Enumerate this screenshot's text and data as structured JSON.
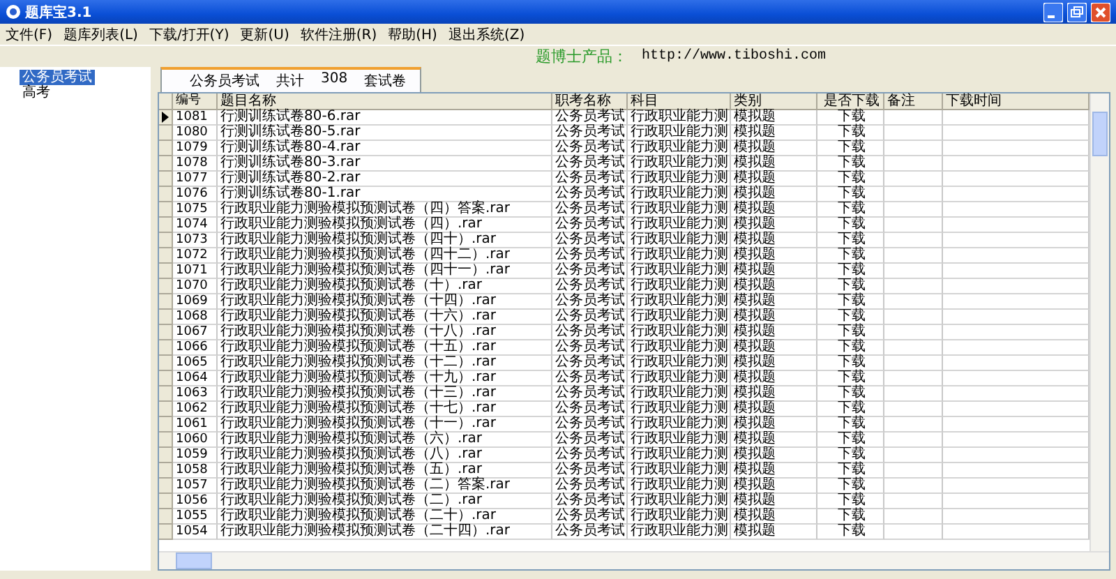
{
  "window": {
    "title": "题库宝3.1"
  },
  "menu": [
    "文件(F)",
    "题库列表(L)",
    "下载/打开(Y)",
    "更新(U)",
    "软件注册(R)",
    "帮助(H)",
    "退出系统(Z)"
  ],
  "banner": {
    "label": "题博士产品：",
    "url": "http://www.tiboshi.com"
  },
  "tree": [
    {
      "label": "公务员考试",
      "selected": true
    },
    {
      "label": "高考",
      "selected": false
    }
  ],
  "tab": {
    "parts": [
      "公务员考试",
      "共计",
      "308",
      "套试卷"
    ],
    "selected": true
  },
  "table": {
    "columns": [
      "编号",
      "题目名称",
      "职考名称",
      "科目",
      "类别",
      "是否下载",
      "备注",
      "下载时间"
    ],
    "rows": [
      {
        "id": "1081",
        "title": "行测训练试卷80-6.rar",
        "exam": "公务员考试",
        "subject": "行政职业能力测",
        "category": "模拟题",
        "download": "下载",
        "current": true
      },
      {
        "id": "1080",
        "title": "行测训练试卷80-5.rar",
        "exam": "公务员考试",
        "subject": "行政职业能力测",
        "category": "模拟题",
        "download": "下载",
        "current": false
      },
      {
        "id": "1079",
        "title": "行测训练试卷80-4.rar",
        "exam": "公务员考试",
        "subject": "行政职业能力测",
        "category": "模拟题",
        "download": "下载",
        "current": false
      },
      {
        "id": "1078",
        "title": "行测训练试卷80-3.rar",
        "exam": "公务员考试",
        "subject": "行政职业能力测",
        "category": "模拟题",
        "download": "下载",
        "current": false
      },
      {
        "id": "1077",
        "title": "行测训练试卷80-2.rar",
        "exam": "公务员考试",
        "subject": "行政职业能力测",
        "category": "模拟题",
        "download": "下载",
        "current": false
      },
      {
        "id": "1076",
        "title": "行测训练试卷80-1.rar",
        "exam": "公务员考试",
        "subject": "行政职业能力测",
        "category": "模拟题",
        "download": "下载",
        "current": false
      },
      {
        "id": "1075",
        "title": "行政职业能力测验模拟预测试卷（四）答案.rar",
        "exam": "公务员考试",
        "subject": "行政职业能力测",
        "category": "模拟题",
        "download": "下载",
        "current": false
      },
      {
        "id": "1074",
        "title": "行政职业能力测验模拟预测试卷（四）.rar",
        "exam": "公务员考试",
        "subject": "行政职业能力测",
        "category": "模拟题",
        "download": "下载",
        "current": false
      },
      {
        "id": "1073",
        "title": "行政职业能力测验模拟预测试卷（四十）.rar",
        "exam": "公务员考试",
        "subject": "行政职业能力测",
        "category": "模拟题",
        "download": "下载",
        "current": false
      },
      {
        "id": "1072",
        "title": "行政职业能力测验模拟预测试卷（四十二）.rar",
        "exam": "公务员考试",
        "subject": "行政职业能力测",
        "category": "模拟题",
        "download": "下载",
        "current": false
      },
      {
        "id": "1071",
        "title": "行政职业能力测验模拟预测试卷（四十一）.rar",
        "exam": "公务员考试",
        "subject": "行政职业能力测",
        "category": "模拟题",
        "download": "下载",
        "current": false
      },
      {
        "id": "1070",
        "title": "行政职业能力测验模拟预测试卷（十）.rar",
        "exam": "公务员考试",
        "subject": "行政职业能力测",
        "category": "模拟题",
        "download": "下载",
        "current": false
      },
      {
        "id": "1069",
        "title": "行政职业能力测验模拟预测试卷（十四）.rar",
        "exam": "公务员考试",
        "subject": "行政职业能力测",
        "category": "模拟题",
        "download": "下载",
        "current": false
      },
      {
        "id": "1068",
        "title": "行政职业能力测验模拟预测试卷（十六）.rar",
        "exam": "公务员考试",
        "subject": "行政职业能力测",
        "category": "模拟题",
        "download": "下载",
        "current": false
      },
      {
        "id": "1067",
        "title": "行政职业能力测验模拟预测试卷（十八）.rar",
        "exam": "公务员考试",
        "subject": "行政职业能力测",
        "category": "模拟题",
        "download": "下载",
        "current": false
      },
      {
        "id": "1066",
        "title": "行政职业能力测验模拟预测试卷（十五）.rar",
        "exam": "公务员考试",
        "subject": "行政职业能力测",
        "category": "模拟题",
        "download": "下载",
        "current": false
      },
      {
        "id": "1065",
        "title": "行政职业能力测验模拟预测试卷（十二）.rar",
        "exam": "公务员考试",
        "subject": "行政职业能力测",
        "category": "模拟题",
        "download": "下载",
        "current": false
      },
      {
        "id": "1064",
        "title": "行政职业能力测验模拟预测试卷（十九）.rar",
        "exam": "公务员考试",
        "subject": "行政职业能力测",
        "category": "模拟题",
        "download": "下载",
        "current": false
      },
      {
        "id": "1063",
        "title": "行政职业能力测验模拟预测试卷（十三）.rar",
        "exam": "公务员考试",
        "subject": "行政职业能力测",
        "category": "模拟题",
        "download": "下载",
        "current": false
      },
      {
        "id": "1062",
        "title": "行政职业能力测验模拟预测试卷（十七）.rar",
        "exam": "公务员考试",
        "subject": "行政职业能力测",
        "category": "模拟题",
        "download": "下载",
        "current": false
      },
      {
        "id": "1061",
        "title": "行政职业能力测验模拟预测试卷（十一）.rar",
        "exam": "公务员考试",
        "subject": "行政职业能力测",
        "category": "模拟题",
        "download": "下载",
        "current": false
      },
      {
        "id": "1060",
        "title": "行政职业能力测验模拟预测试卷（六）.rar",
        "exam": "公务员考试",
        "subject": "行政职业能力测",
        "category": "模拟题",
        "download": "下载",
        "current": false
      },
      {
        "id": "1059",
        "title": "行政职业能力测验模拟预测试卷（八）.rar",
        "exam": "公务员考试",
        "subject": "行政职业能力测",
        "category": "模拟题",
        "download": "下载",
        "current": false
      },
      {
        "id": "1058",
        "title": "行政职业能力测验模拟预测试卷（五）.rar",
        "exam": "公务员考试",
        "subject": "行政职业能力测",
        "category": "模拟题",
        "download": "下载",
        "current": false
      },
      {
        "id": "1057",
        "title": "行政职业能力测验模拟预测试卷（二）答案.rar",
        "exam": "公务员考试",
        "subject": "行政职业能力测",
        "category": "模拟题",
        "download": "下载",
        "current": false
      },
      {
        "id": "1056",
        "title": "行政职业能力测验模拟预测试卷（二）.rar",
        "exam": "公务员考试",
        "subject": "行政职业能力测",
        "category": "模拟题",
        "download": "下载",
        "current": false
      },
      {
        "id": "1055",
        "title": "行政职业能力测验模拟预测试卷（二十）.rar",
        "exam": "公务员考试",
        "subject": "行政职业能力测",
        "category": "模拟题",
        "download": "下载",
        "current": false
      },
      {
        "id": "1054",
        "title": "行政职业能力测验模拟预测试卷（二十四）.rar",
        "exam": "公务员考试",
        "subject": "行政职业能力测",
        "category": "模拟题",
        "download": "下载",
        "current": false
      }
    ]
  }
}
